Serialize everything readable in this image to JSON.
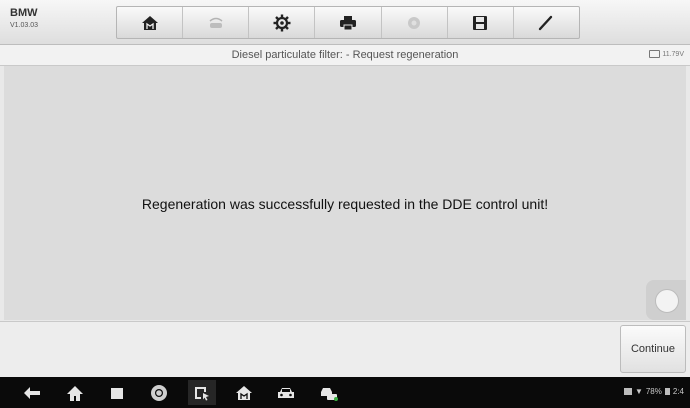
{
  "header": {
    "brand": "BMW",
    "version": "V1.03.03"
  },
  "toolbar": {
    "buttons": [
      {
        "icon": "home-icon"
      },
      {
        "icon": "vehicle-swap-icon"
      },
      {
        "icon": "gear-icon"
      },
      {
        "icon": "printer-icon"
      },
      {
        "icon": "help-icon"
      },
      {
        "icon": "save-icon"
      },
      {
        "icon": "pen-icon"
      }
    ]
  },
  "title_bar": {
    "title": "Diesel particulate filter: - Request regeneration",
    "battery_voltage": "11.79V"
  },
  "content": {
    "message": "Regeneration was successfully requested in the DDE control unit!"
  },
  "actions": {
    "continue_label": "Continue"
  },
  "android_nav": {
    "items": [
      "back-icon",
      "home-icon",
      "recent-apps-icon",
      "chrome-icon",
      "screen-capture-icon",
      "diagnostics-icon",
      "car-icon",
      "vci-connection-icon"
    ]
  },
  "status_bar": {
    "battery_percent": "78%",
    "clock": "2:4"
  },
  "colors": {
    "background": "#dcdcdc",
    "navbar": "#0a0a0a"
  }
}
